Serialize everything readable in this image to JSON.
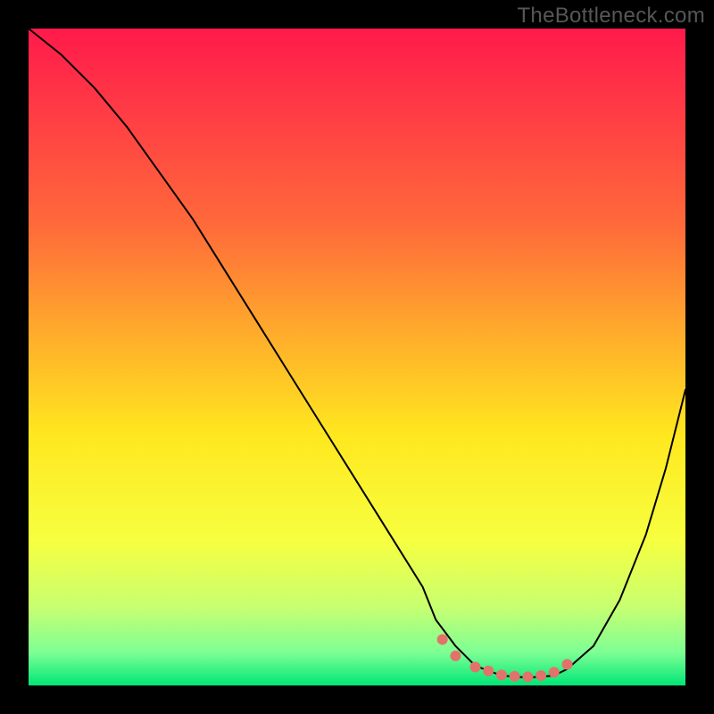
{
  "watermark": "TheBottleneck.com",
  "chart_data": {
    "type": "line",
    "title": "",
    "xlabel": "",
    "ylabel": "",
    "xlim": [
      0,
      100
    ],
    "ylim": [
      0,
      100
    ],
    "grid": false,
    "gradient_stops": [
      {
        "offset": 0,
        "color": "#ff1a4b"
      },
      {
        "offset": 12,
        "color": "#ff3a45"
      },
      {
        "offset": 30,
        "color": "#ff6a3a"
      },
      {
        "offset": 48,
        "color": "#ffb22a"
      },
      {
        "offset": 62,
        "color": "#ffe81f"
      },
      {
        "offset": 78,
        "color": "#f6ff40"
      },
      {
        "offset": 88,
        "color": "#c8ff70"
      },
      {
        "offset": 95,
        "color": "#7dff94"
      },
      {
        "offset": 100,
        "color": "#00e676"
      }
    ],
    "series": [
      {
        "name": "curve",
        "color": "#000000",
        "width": 2,
        "x": [
          0,
          5,
          10,
          15,
          20,
          25,
          30,
          35,
          40,
          45,
          50,
          55,
          60,
          62,
          65,
          68,
          72,
          76,
          80,
          82,
          86,
          90,
          94,
          97,
          100
        ],
        "values": [
          100,
          96,
          91,
          85,
          78,
          71,
          63,
          55,
          47,
          39,
          31,
          23,
          15,
          10,
          6,
          3,
          1.5,
          1.2,
          1.5,
          2.5,
          6,
          13,
          23,
          33,
          45
        ]
      }
    ],
    "markers": {
      "name": "bottom-markers",
      "color": "#e2736b",
      "radius": 6,
      "x": [
        63,
        65,
        68,
        70,
        72,
        74,
        76,
        78,
        80,
        82
      ],
      "values": [
        7,
        4.5,
        2.8,
        2.2,
        1.6,
        1.4,
        1.3,
        1.5,
        2.0,
        3.2
      ]
    }
  }
}
